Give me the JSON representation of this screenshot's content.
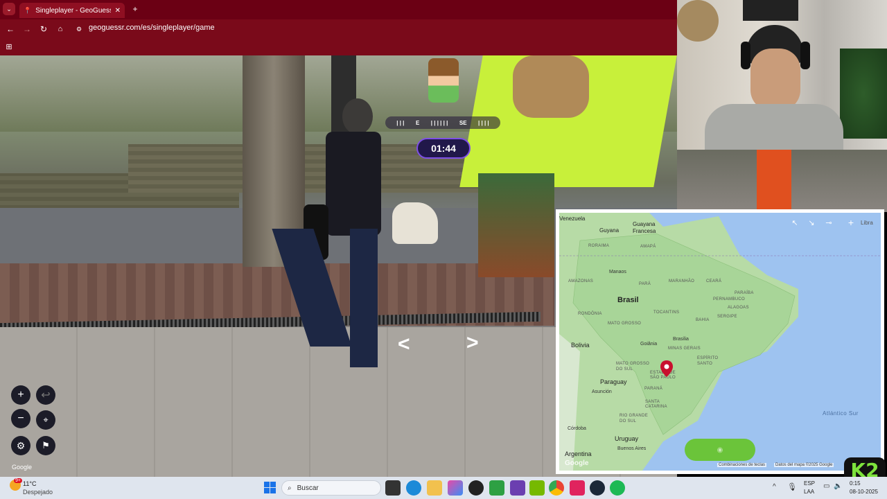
{
  "browser": {
    "tab_title": "Singleplayer - GeoGuessr",
    "url": "geoguessr.com/es/singleplayer/game",
    "close_tab": "✕",
    "new_tab": "+"
  },
  "game": {
    "compass": {
      "e": "E",
      "se": "SE"
    },
    "timer": "01:44",
    "google_watermark": "Google"
  },
  "map": {
    "countries": {
      "venezuela": "Venezuela",
      "guyana": "Guyana",
      "french_guiana": "Guayana Francesa",
      "brasil": "Brasil",
      "bolivia": "Bolivia",
      "paraguay": "Paraguay",
      "argentina": "Argentina",
      "uruguay": "Uruguay"
    },
    "states": {
      "roraima": "RORAIMA",
      "amapa": "AMAPÁ",
      "amazonas": "AMAZONAS",
      "para": "PARÁ",
      "maranhao": "MARANHÃO",
      "ceara": "CEARÁ",
      "paraiba": "PARAÍBA",
      "pernambuco": "PERNAMBUCO",
      "alagoas": "ALAGOAS",
      "sergipe": "SERGIPE",
      "rondonia": "RONDÔNIA",
      "mato_grosso": "MATO GROSSO",
      "tocantins": "TOCANTINS",
      "bahia": "BAHIA",
      "minas_gerais": "MINAS GERAIS",
      "espirito_santo": "ESPÍRITO SANTO",
      "mato_grosso_sul": "MATO GROSSO DO SUL",
      "sao_paulo": "ESTADO DE SÃO PAULO",
      "parana": "PARANÁ",
      "santa_catarina": "SANTA CATARINA",
      "rio_grande_sul": "RIO GRANDE DO SUL"
    },
    "cities": {
      "manaus": "Manaos",
      "brasilia": "Brasilia",
      "goiania": "Goiânia",
      "asuncion": "Asunción",
      "cordoba": "Córdoba",
      "buenos_aires": "Buenos Aires"
    },
    "ocean": "Atlántico Sur",
    "corner_label": "Libra",
    "attribution_shortcuts": "Combinaciones de teclas",
    "attribution_data": "Datos del mapa ©2025 Google",
    "google": "Google"
  },
  "taskbar": {
    "weather_temp": "11°C",
    "weather_desc": "Despejado",
    "search_placeholder": "Buscar",
    "lang_top": "ESP",
    "lang_bottom": "LAA",
    "date": "08-10-2025",
    "time": "0:15",
    "notif_badge": "9+"
  },
  "overlay": {
    "logo": "K2"
  },
  "colors": {
    "chrome": "#7a0a1a",
    "timer_border": "#7e4fe6",
    "guess_button": "#6bc43a",
    "pin": "#c8102e"
  }
}
